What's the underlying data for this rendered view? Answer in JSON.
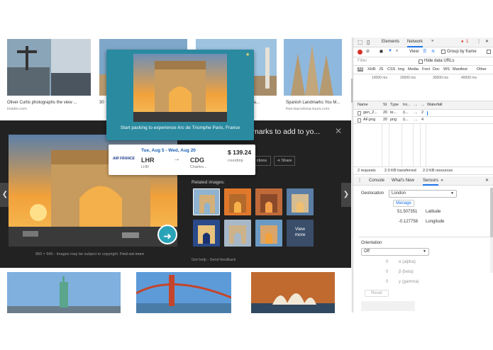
{
  "grid": {
    "row1": [
      {
        "title": "Oliver Curtis photographs the view ...",
        "source": "insider.com"
      },
      {
        "title": "30",
        "source": ""
      },
      {
        "title": "arks | Tra...",
        "source": ""
      },
      {
        "title": "Spanish Landmarks You M...",
        "source": "free-barcelona-tours.com"
      }
    ]
  },
  "panel": {
    "title_partial": "marks to add to yo...",
    "close_glyph": "✕",
    "actions": [
      "ctions",
      "Share"
    ],
    "related_label": "Related images:",
    "view_more": "View more",
    "dims_text": "960 × 640 - Images may be subject to copyright.",
    "find_out_more": "Find out more",
    "get_help": "Get help",
    "send_feedback": "Send feedback",
    "separator": "-",
    "prev_glyph": "❮",
    "next_glyph": "❯"
  },
  "popup": {
    "caption": "Start packing to experience Arc de Triomphe Paris, France",
    "star": "★",
    "dates": "Tue, Aug 5 - Wed, Aug 20",
    "airline": "AIR FRANCE",
    "from_code": "LHR",
    "from_city": "LHR",
    "to_code": "CDG",
    "to_city": "Charles...",
    "price": "$ 139.24",
    "trip_type": "roundtrip",
    "arrow": "→"
  },
  "devtools": {
    "tabs": [
      "Elements",
      "Network"
    ],
    "more_tabs": "»",
    "error_count": "1",
    "view_label": "View:",
    "group_by_frame": "Group by frame",
    "filter_placeholder": "Filter",
    "hide_data_urls": "Hide data URLs",
    "type_filters": [
      "All",
      "XHR",
      "JS",
      "CSS",
      "Img",
      "Media",
      "Font",
      "Doc",
      "WS",
      "Manifest",
      "Other"
    ],
    "timeline_ticks": [
      "10000 ms",
      "20000 ms",
      "30000 ms",
      "40000 ms"
    ],
    "columns": [
      "Name",
      "St",
      "Type",
      "Ini...",
      "...",
      "...",
      "Waterfall"
    ],
    "rows": [
      {
        "name": "gen_2...",
        "status": "20",
        "type": "te...",
        "initiator": "(i...",
        "c5": "...",
        "c6": "2"
      },
      {
        "name": "AF.png",
        "status": "20",
        "type": "png",
        "initiator": "(i...",
        "c5": "...",
        "c6": "4"
      }
    ],
    "summary": {
      "requests": "2 requests",
      "transferred": "2.0 KB transferred",
      "resources": "2.0 KB resources"
    },
    "drawer_tabs": [
      "Console",
      "What's New",
      "Sensors"
    ],
    "geolocation_label": "Geolocation",
    "geolocation_value": "London",
    "manage_label": "Manage",
    "latitude_value": "51.507351",
    "latitude_label": "Latitude",
    "longitude_value": "-0.127758",
    "longitude_label": "Longitude",
    "orientation_label": "Orientation",
    "orientation_value": "Off",
    "alpha_value": "0",
    "alpha_label": "α (alpha)",
    "beta_value": "0",
    "beta_label": "β (beta)",
    "gamma_value": "0",
    "gamma_label": "γ (gamma)",
    "reset_label": "Reset",
    "close_glyph": "✕"
  },
  "colors": {
    "popup_bg": "#2a8aa0",
    "record_red": "#d93025",
    "devtools_blue": "#1a73e8"
  }
}
